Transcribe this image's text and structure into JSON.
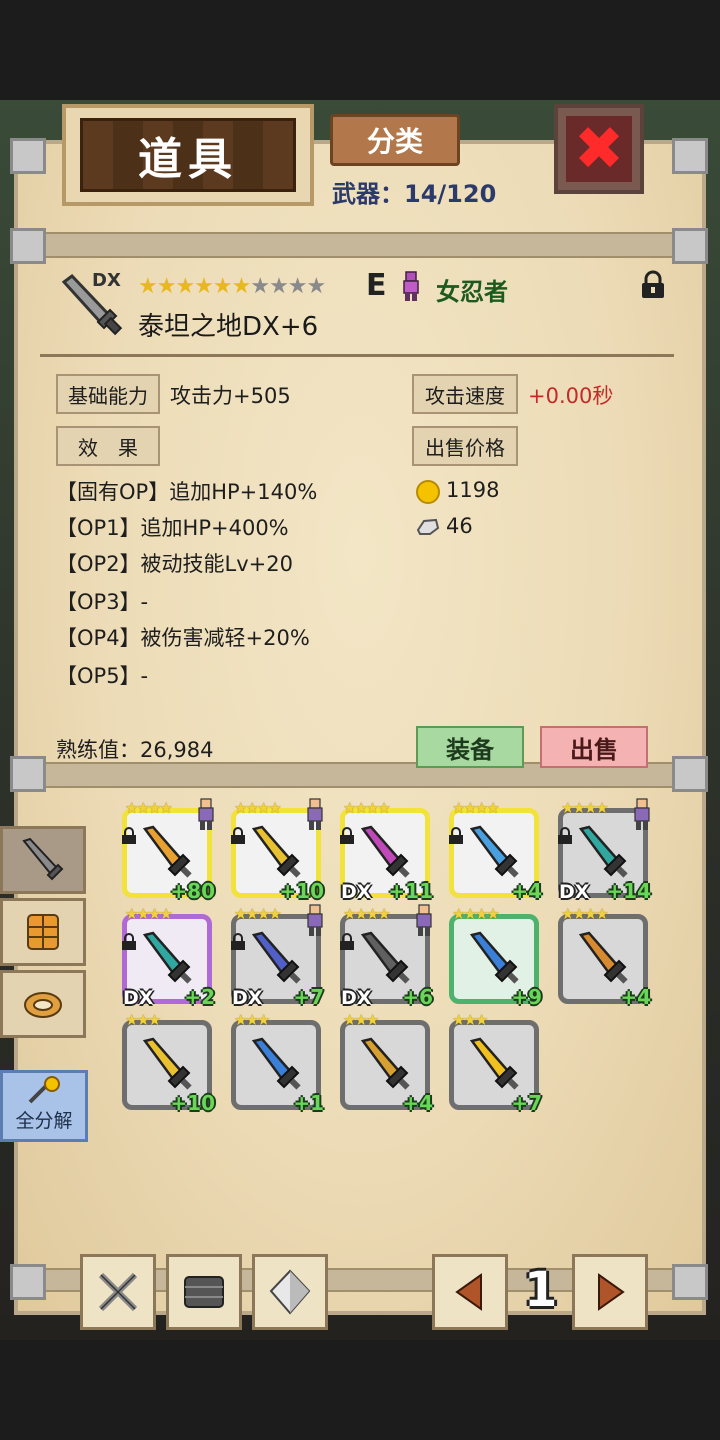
{
  "header": {
    "title": "道具",
    "category_button": "分类",
    "weapon_count_label": "武器：",
    "weapon_count": "14/120"
  },
  "item": {
    "dx_tag": "DX",
    "stars_filled": 6,
    "stars_total": 10,
    "rank": "E",
    "class_name": "女忍者",
    "name": "泰坦之地DX+6",
    "locked": true
  },
  "stats": {
    "base_label": "基础能力",
    "base_value": "攻击力+505",
    "speed_label": "攻击速度",
    "speed_value": "+0.00秒",
    "effect_label": "效　果",
    "price_label": "出售价格",
    "price_gold": "1198",
    "price_ore": "46",
    "ops": [
      "【固有OP】追加HP+140%",
      "【OP1】追加HP+400%",
      "【OP2】被动技能Lv+20",
      "【OP3】-",
      "【OP4】被伤害减轻+20%",
      "【OP5】-"
    ],
    "proficiency_label": "熟练值：",
    "proficiency_value": "26,984"
  },
  "actions": {
    "equip": "装备",
    "sell": "出售"
  },
  "side": {
    "disassemble_all": "全分解"
  },
  "grid": [
    {
      "plus": "+80",
      "dx": "",
      "frame": "gold",
      "locked": true,
      "stars": "★★★★",
      "color": "#e8a030",
      "char": true
    },
    {
      "plus": "+10",
      "dx": "",
      "frame": "gold",
      "locked": true,
      "stars": "★★★★",
      "color": "#e8c030",
      "char": true
    },
    {
      "plus": "+11",
      "dx": "DX",
      "frame": "gold",
      "locked": true,
      "stars": "★★★★",
      "color": "#c048b8",
      "char": false
    },
    {
      "plus": "+4",
      "dx": "",
      "frame": "gold",
      "locked": true,
      "stars": "★★★★",
      "color": "#48a0e0",
      "char": false
    },
    {
      "plus": "+14",
      "dx": "DX",
      "frame": "grey",
      "locked": true,
      "stars": "★★★★",
      "color": "#30a8a0",
      "char": true
    },
    {
      "plus": "+2",
      "dx": "DX",
      "frame": "purple",
      "locked": true,
      "stars": "★★★★",
      "color": "#30a8a0",
      "char": false
    },
    {
      "plus": "+7",
      "dx": "DX",
      "frame": "grey",
      "locked": true,
      "stars": "★★★★",
      "color": "#5060c8",
      "char": true
    },
    {
      "plus": "+6",
      "dx": "DX",
      "frame": "grey",
      "locked": true,
      "stars": "★★★★",
      "color": "#606060",
      "char": true
    },
    {
      "plus": "+9",
      "dx": "",
      "frame": "green",
      "locked": false,
      "stars": "★★★★",
      "color": "#3a7fd8",
      "char": false
    },
    {
      "plus": "+4",
      "dx": "",
      "frame": "grey",
      "locked": false,
      "stars": "★★★★",
      "color": "#d88a30",
      "char": false
    },
    {
      "plus": "+10",
      "dx": "",
      "frame": "grey",
      "locked": false,
      "stars": "★★★",
      "color": "#e8c030",
      "char": false
    },
    {
      "plus": "+1",
      "dx": "",
      "frame": "grey",
      "locked": false,
      "stars": "★★★",
      "color": "#3a7fd8",
      "char": false
    },
    {
      "plus": "+4",
      "dx": "",
      "frame": "grey",
      "locked": false,
      "stars": "★★★",
      "color": "#d8a030",
      "char": false
    },
    {
      "plus": "+7",
      "dx": "",
      "frame": "grey",
      "locked": false,
      "stars": "★★★",
      "color": "#f0c020",
      "char": false
    }
  ],
  "pager": {
    "page": "1"
  },
  "colors": {
    "parchment": "#ecdbb6",
    "accent_red": "#c42a2a",
    "class_green": "#1d5a1d",
    "equip_green": "#a8d9a0",
    "sell_pink": "#f4b2b2"
  }
}
